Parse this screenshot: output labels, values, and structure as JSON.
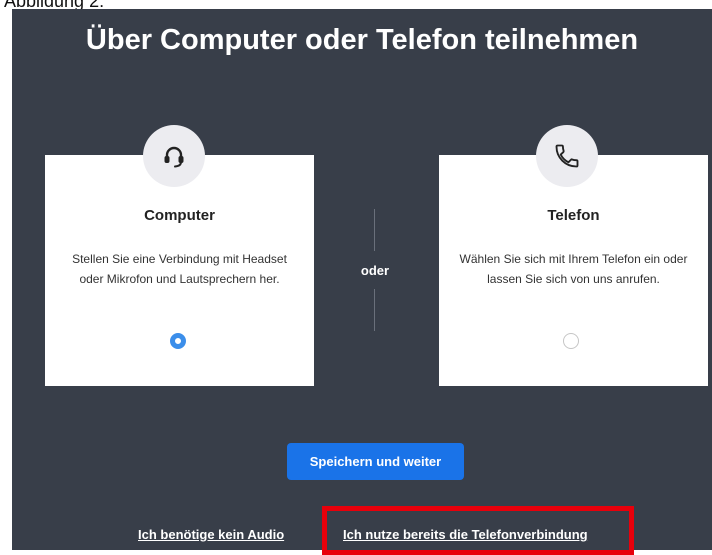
{
  "caption": "Abbildung 2:",
  "dialog": {
    "title": "Über Computer oder Telefon teilnehmen",
    "or_label": "oder",
    "options": {
      "computer": {
        "icon": "headset-icon",
        "title": "Computer",
        "description": "Stellen Sie eine Verbindung mit Headset oder Mikrofon und Lautsprechern her.",
        "selected": true
      },
      "phone": {
        "icon": "phone-icon",
        "title": "Telefon",
        "description": "Wählen Sie sich mit Ihrem Telefon ein oder lassen Sie sich von uns anrufen.",
        "selected": false
      }
    },
    "primary_button": "Speichern und weiter",
    "links": {
      "no_audio": "Ich benötige kein Audio",
      "phone_connected": "Ich nutze bereits die Telefonverbindung"
    }
  },
  "colors": {
    "panel_background": "#383e49",
    "primary": "#1a73e8",
    "selected_radio": "#3b8eea",
    "highlight": "#e8000b"
  }
}
